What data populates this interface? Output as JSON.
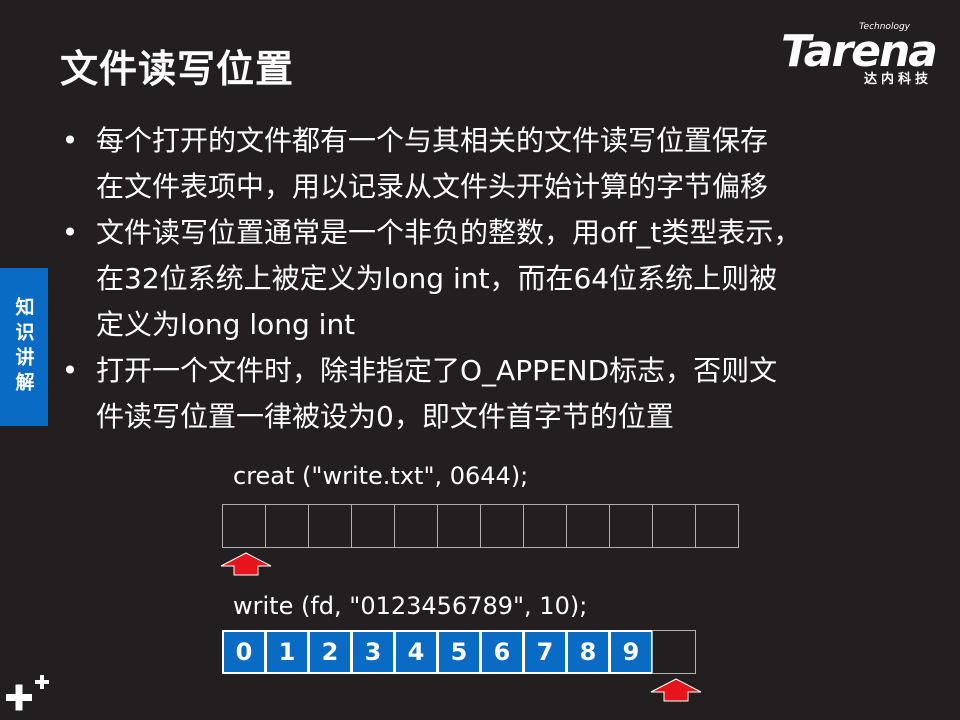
{
  "title": "文件读写位置",
  "logo": {
    "superscript": "Technology",
    "wordmark": "Tarena",
    "chinese": "达内科技"
  },
  "side_tab": "知识讲解",
  "bullets": [
    {
      "lines": [
        "每个打开的文件都有一个与其相关的文件读写位置保存",
        "在文件表项中，用以记录从文件头开始计算的字节偏移"
      ]
    },
    {
      "lines": [
        "文件读写位置通常是一个非负的整数，用off_t类型表示，",
        "在32位系统上被定义为long int，而在64位系统上则被",
        "定义为long long int"
      ]
    },
    {
      "lines": [
        "打开一个文件时，除非指定了O_APPEND标志，否则文",
        "件读写位置一律被设为0，即文件首字节的位置"
      ]
    }
  ],
  "example1": {
    "code": "creat (\"write.txt\", 0644);",
    "cells": [
      "",
      "",
      "",
      "",
      "",
      "",
      "",
      "",
      "",
      "",
      "",
      ""
    ],
    "pointer_index": 0
  },
  "example2": {
    "code": "write (fd, \"0123456789\", 10);",
    "cells": [
      "0",
      "1",
      "2",
      "3",
      "4",
      "5",
      "6",
      "7",
      "8",
      "9",
      ""
    ],
    "pointer_index": 10
  },
  "colors": {
    "background": "#231f20",
    "accent": "#0a6bc4",
    "arrow": "#e8141b"
  }
}
